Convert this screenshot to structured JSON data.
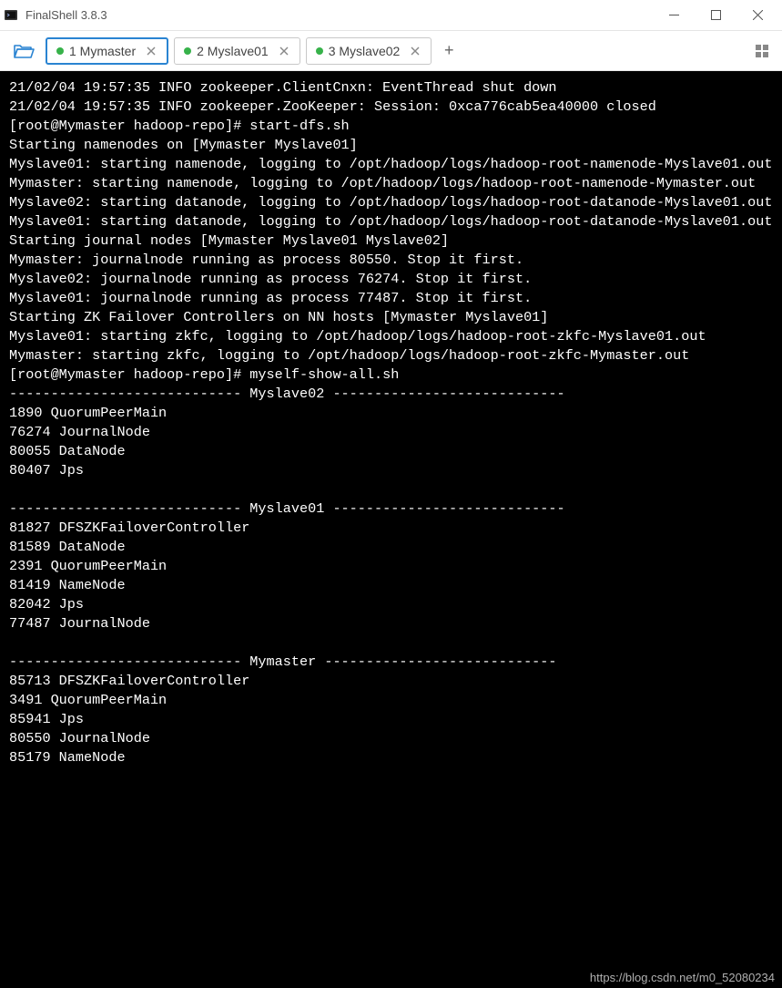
{
  "titlebar": {
    "title": "FinalShell 3.8.3"
  },
  "tabs": [
    {
      "label": "1 Mymaster",
      "active": true
    },
    {
      "label": "2 Myslave01",
      "active": false
    },
    {
      "label": "3 Myslave02",
      "active": false
    }
  ],
  "terminal": {
    "content": "21/02/04 19:57:35 INFO zookeeper.ClientCnxn: EventThread shut down\n21/02/04 19:57:35 INFO zookeeper.ZooKeeper: Session: 0xca776cab5ea40000 closed\n[root@Mymaster hadoop-repo]# start-dfs.sh\nStarting namenodes on [Mymaster Myslave01]\nMyslave01: starting namenode, logging to /opt/hadoop/logs/hadoop-root-namenode-Myslave01.out\nMymaster: starting namenode, logging to /opt/hadoop/logs/hadoop-root-namenode-Mymaster.out\nMyslave02: starting datanode, logging to /opt/hadoop/logs/hadoop-root-datanode-Myslave01.out\nMyslave01: starting datanode, logging to /opt/hadoop/logs/hadoop-root-datanode-Myslave01.out\nStarting journal nodes [Mymaster Myslave01 Myslave02]\nMymaster: journalnode running as process 80550. Stop it first.\nMyslave02: journalnode running as process 76274. Stop it first.\nMyslave01: journalnode running as process 77487. Stop it first.\nStarting ZK Failover Controllers on NN hosts [Mymaster Myslave01]\nMyslave01: starting zkfc, logging to /opt/hadoop/logs/hadoop-root-zkfc-Myslave01.out\nMymaster: starting zkfc, logging to /opt/hadoop/logs/hadoop-root-zkfc-Mymaster.out\n[root@Mymaster hadoop-repo]# myself-show-all.sh\n---------------------------- Myslave02 ----------------------------\n1890 QuorumPeerMain\n76274 JournalNode\n80055 DataNode\n80407 Jps\n\n---------------------------- Myslave01 ----------------------------\n81827 DFSZKFailoverController\n81589 DataNode\n2391 QuorumPeerMain\n81419 NameNode\n82042 Jps\n77487 JournalNode\n\n---------------------------- Mymaster ----------------------------\n85713 DFSZKFailoverController\n3491 QuorumPeerMain\n85941 Jps\n80550 JournalNode\n85179 NameNode"
  },
  "watermark": "https://blog.csdn.net/m0_52080234"
}
